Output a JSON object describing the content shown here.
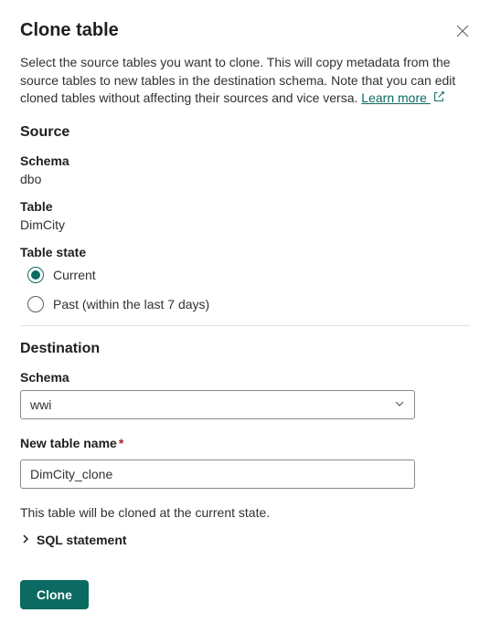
{
  "dialog": {
    "title": "Clone table",
    "description": "Select the source tables you want to clone. This will copy metadata from the source tables to new tables in the destination schema. Note that you can edit cloned tables without affecting their sources and vice versa. ",
    "learn_more": "Learn more "
  },
  "source": {
    "heading": "Source",
    "schema_label": "Schema",
    "schema_value": "dbo",
    "table_label": "Table",
    "table_value": "DimCity",
    "state_label": "Table state",
    "radio_current": "Current",
    "radio_past": "Past (within the last 7 days)"
  },
  "destination": {
    "heading": "Destination",
    "schema_label": "Schema",
    "schema_value": "wwi",
    "new_table_label": "New table name",
    "new_table_value": "DimCity_clone"
  },
  "hint": "This table will be cloned at the current state.",
  "sql_expander": "SQL statement",
  "actions": {
    "clone": "Clone"
  }
}
